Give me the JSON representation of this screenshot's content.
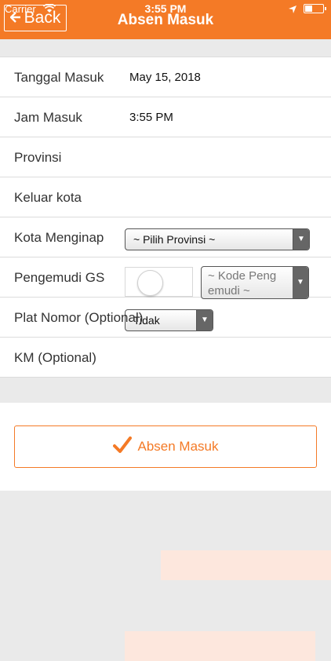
{
  "status_bar": {
    "carrier": "Carrier",
    "time": "3:55 PM"
  },
  "header": {
    "back_label": "Back",
    "title": "Absen Masuk",
    "color": "#f47a26"
  },
  "form": {
    "tanggal_label": "Tanggal Masuk",
    "tanggal_value": "May 15, 2018",
    "jam_label": "Jam Masuk",
    "jam_value": "3:55 PM",
    "provinsi_label": "Provinsi",
    "provinsi_selected": "~ Pilih Provinsi ~",
    "keluar_label": "Keluar kota",
    "keluar_selected": "Tidak",
    "kota_label": "Kota Menginap",
    "kota_value": "",
    "pengemudi_label": "Pengemudi GS",
    "kode_pengemudi_placeholder": "~ Kode Peng emudi ~",
    "plat_label": "Plat Nomor (Optional)",
    "plat_value": "",
    "km_label": "KM (Optional)",
    "km_value": ""
  },
  "action": {
    "submit_label": "Absen Masuk"
  },
  "icons": {
    "back": "back-arrow-icon",
    "check": "check-icon",
    "wifi": "wifi-icon",
    "location": "location-icon",
    "battery": "battery-icon"
  }
}
